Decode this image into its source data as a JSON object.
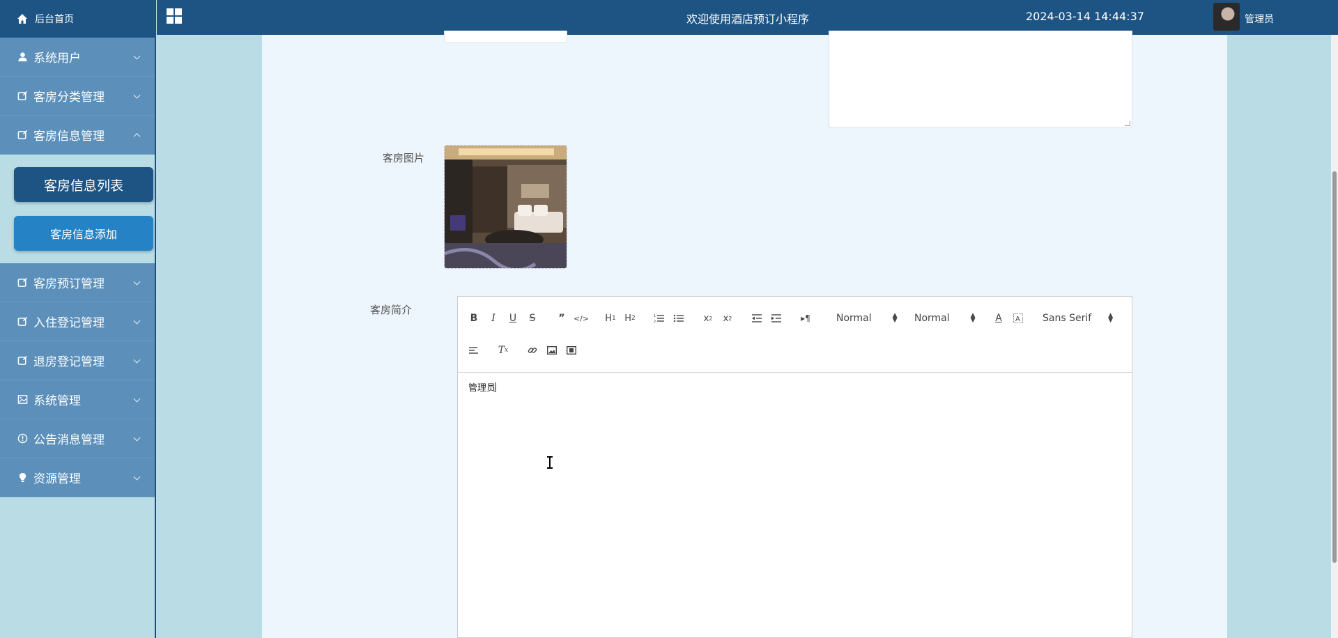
{
  "sidebar": {
    "home_label": "后台首页",
    "items": [
      {
        "label": "系统用户",
        "icon": "user-icon"
      },
      {
        "label": "客房分类管理",
        "icon": "edit-box-icon"
      },
      {
        "label": "客房信息管理",
        "icon": "edit-box-icon",
        "expanded": true
      },
      {
        "label": "客房预订管理",
        "icon": "edit-box-icon"
      },
      {
        "label": "入住登记管理",
        "icon": "edit-box-icon"
      },
      {
        "label": "退房登记管理",
        "icon": "edit-box-icon"
      },
      {
        "label": "系统管理",
        "icon": "image-icon"
      },
      {
        "label": "公告消息管理",
        "icon": "info-circle-icon"
      },
      {
        "label": "资源管理",
        "icon": "bulb-icon"
      }
    ],
    "submenu": {
      "active_label": "客房信息列表",
      "second_label": "客房信息添加"
    }
  },
  "header": {
    "title": "欢迎使用酒店预订小程序",
    "datetime": "2024-03-14 14:44:37",
    "username": "管理员"
  },
  "form": {
    "image_label": "客房图片",
    "intro_label": "客房简介",
    "editor_content": "管理员"
  },
  "editor_toolbar": {
    "header_select": "Normal",
    "size_select": "Normal",
    "font_select": "Sans Serif",
    "buttons": [
      "bold",
      "italic",
      "underline",
      "strike",
      "blockquote",
      "code-block",
      "h1",
      "h2",
      "ordered-list",
      "bullet-list",
      "subscript",
      "superscript",
      "outdent",
      "indent",
      "rtl",
      "text-color",
      "background-color",
      "align",
      "clean",
      "link",
      "image",
      "video"
    ]
  },
  "colors": {
    "primary_dark": "#1d5484",
    "sidebar_menu": "#5c8fb9",
    "sidebar_bg": "#badde5",
    "submenu_button": "#2482c5",
    "panel_bg": "#eef6fd"
  }
}
